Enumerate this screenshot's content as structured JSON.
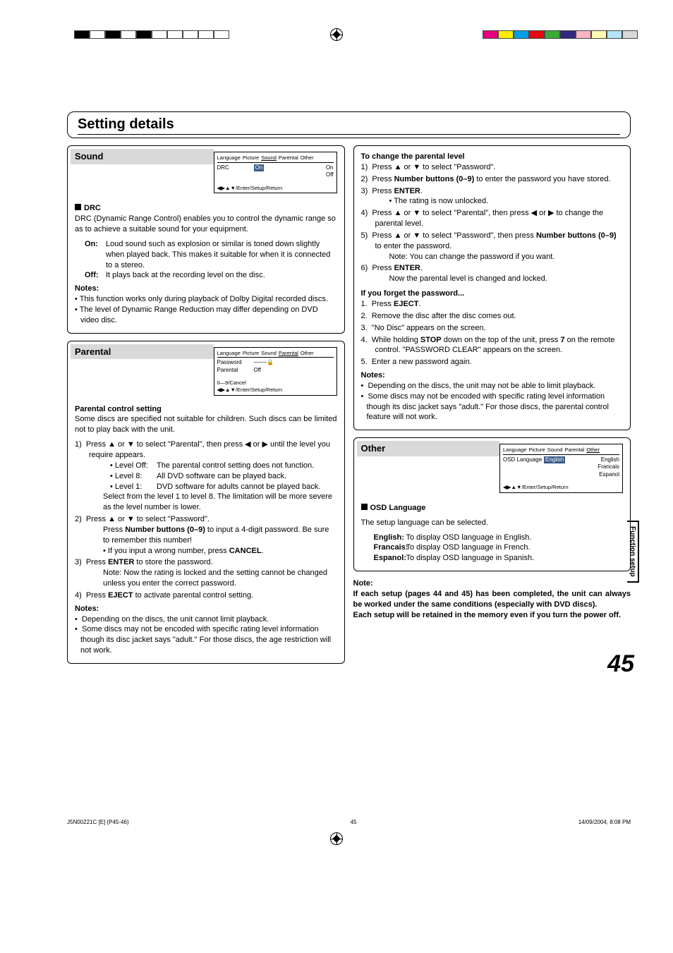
{
  "sideTab": "Function setup",
  "pageNumber": "45",
  "title": "Setting details",
  "footer": {
    "left": "J5N00221C [E] (P45-46)",
    "center": "45",
    "right": "14/09/2004, 8:08 PM"
  },
  "sound": {
    "heading": "Sound",
    "osd": {
      "tabs": [
        "Language",
        "Picture",
        "Sound",
        "Parental",
        "Other"
      ],
      "activeTab": "Sound",
      "rows": [
        {
          "label": "DRC",
          "value": "On",
          "options": [
            "On",
            "Off"
          ]
        }
      ],
      "foot": "◀▶▲▼/Enter/Setup/Return"
    },
    "drcHead": "DRC",
    "drcBody": "DRC (Dynamic Range Control) enables you to control the dynamic range so as to achieve a suitable sound for your equipment.",
    "onLabel": "On:",
    "onText": "Loud sound such as explosion or similar is toned down slightly when played back. This makes it suitable for when it is connected to a stereo.",
    "offLabel": "Off:",
    "offText": "It plays back at the recording level on the disc.",
    "notesHead": "Notes:",
    "notes": [
      "This function works only during playback of Dolby Digital recorded discs.",
      "The level of Dynamic Range Reduction may differ depending on DVD video disc."
    ]
  },
  "parental": {
    "heading": "Parental",
    "osd": {
      "tabs": [
        "Language",
        "Picture",
        "Sound",
        "Parental",
        "Other"
      ],
      "activeTab": "Parental",
      "rows": [
        {
          "label": "Password",
          "value": "– – – – 🔒"
        },
        {
          "label": "Parental",
          "value": "Off"
        }
      ],
      "foot1": "0—9/Cancel",
      "foot2": "◀▶▲▼/Enter/Setup/Return"
    },
    "settingHead": "Parental control setting",
    "settingBody": "Some discs are specified not suitable for children. Such discs can be limited not to play back with the unit.",
    "steps": {
      "s1a": "Press ▲ or ▼ to select \"Parental\", then press ◀ or ▶ until the level you require appears.",
      "lvlOffL": "• Level Off:",
      "lvlOffT": "The parental control setting does not function.",
      "lvl8L": "• Level 8:",
      "lvl8T": "All DVD software can be played back.",
      "lvl1L": "• Level 1:",
      "lvl1T": "DVD software for adults cannot be played back.",
      "s1b": "Select from the level 1 to level 8. The limitation will be more severe as the level number is lower.",
      "s2a": "Press ▲ or ▼ to select \"Password\".",
      "s2b_pre": "Press ",
      "s2b_bold": "Number buttons (0–9)",
      "s2b_post": " to input a 4-digit password. Be sure to remember this number!",
      "s2c_pre": "• If you input a wrong number, press ",
      "s2c_bold": "CANCEL",
      "s2c_post": ".",
      "s3_pre": "Press ",
      "s3_bold": "ENTER",
      "s3_post": " to store the password.",
      "s3n": "Note: Now the rating is locked and the setting cannot be changed unless you enter the correct password.",
      "s4_pre": "Press ",
      "s4_bold": "EJECT",
      "s4_post": " to activate parental control setting."
    },
    "notesHead": "Notes:",
    "notes": [
      "Depending on the discs, the unit cannot limit playback.",
      "Some discs may not be encoded with specific rating level information though its disc jacket says \"adult.\" For those discs, the age restriction will not work."
    ]
  },
  "right1": {
    "changeHead": "To change the parental level",
    "c1": "Press ▲ or ▼ to select \"Password\".",
    "c2_pre": "Press ",
    "c2_bold": "Number buttons (0–9)",
    "c2_post": " to enter the password you have stored.",
    "c3_pre": "Press ",
    "c3_bold": "ENTER",
    "c3_post": ".",
    "c3b": "• The rating is now unlocked.",
    "c4": "Press ▲ or ▼ to select \"Parental\", then press ◀ or ▶ to change the parental level.",
    "c5_a": "Press ▲ or ▼ to select \"Password\", then press ",
    "c5_bold": "Number buttons (0–9)",
    "c5_b": " to enter the password.",
    "c5n": "Note: You can change the password if you want.",
    "c6_pre": "Press ",
    "c6_bold": "ENTER",
    "c6_post": ".",
    "c6b": "Now the parental level is changed and locked.",
    "forgotHead": "If you forget the password...",
    "f1_pre": "Press ",
    "f1_bold": "EJECT",
    "f1_post": ".",
    "f2": "Remove the disc after the disc comes out.",
    "f3": "\"No Disc\" appears on the screen.",
    "f4_pre": "While holding ",
    "f4_bold": "STOP",
    "f4_mid": " down on the top of the unit, press ",
    "f4_bold2": "7",
    "f4_post": " on the remote control. \"PASSWORD CLEAR\" appears on the screen.",
    "f5": "Enter a new password again.",
    "notesHead": "Notes:",
    "notes": [
      "Depending on the discs, the unit may not be able to limit playback.",
      "Some discs may not be encoded with specific rating level information though its disc jacket says \"adult.\" For those discs, the parental control feature will not work."
    ]
  },
  "other": {
    "heading": "Other",
    "osd": {
      "tabs": [
        "Language",
        "Picture",
        "Sound",
        "Parental",
        "Other"
      ],
      "activeTab": "Other",
      "label": "OSD Language",
      "value": "English",
      "options": [
        "English",
        "Francais",
        "Espanol"
      ],
      "foot": "◀▶▲▼/Enter/Setup/Return"
    },
    "osdHead": "OSD Language",
    "osdBody": "The setup language can be selected.",
    "langs": [
      {
        "l": "English:",
        "t": "To display OSD language in English."
      },
      {
        "l": "Francais:",
        "t": "To display OSD language in French."
      },
      {
        "l": "Espanol:",
        "t": "To display OSD language in Spanish."
      }
    ],
    "noteHead": "Note:",
    "noteBody": "If each setup (pages 44 and 45) has been completed, the unit can always be worked under the same conditions (especially with DVD discs).\nEach setup will be retained in the memory even if you turn the power off."
  }
}
